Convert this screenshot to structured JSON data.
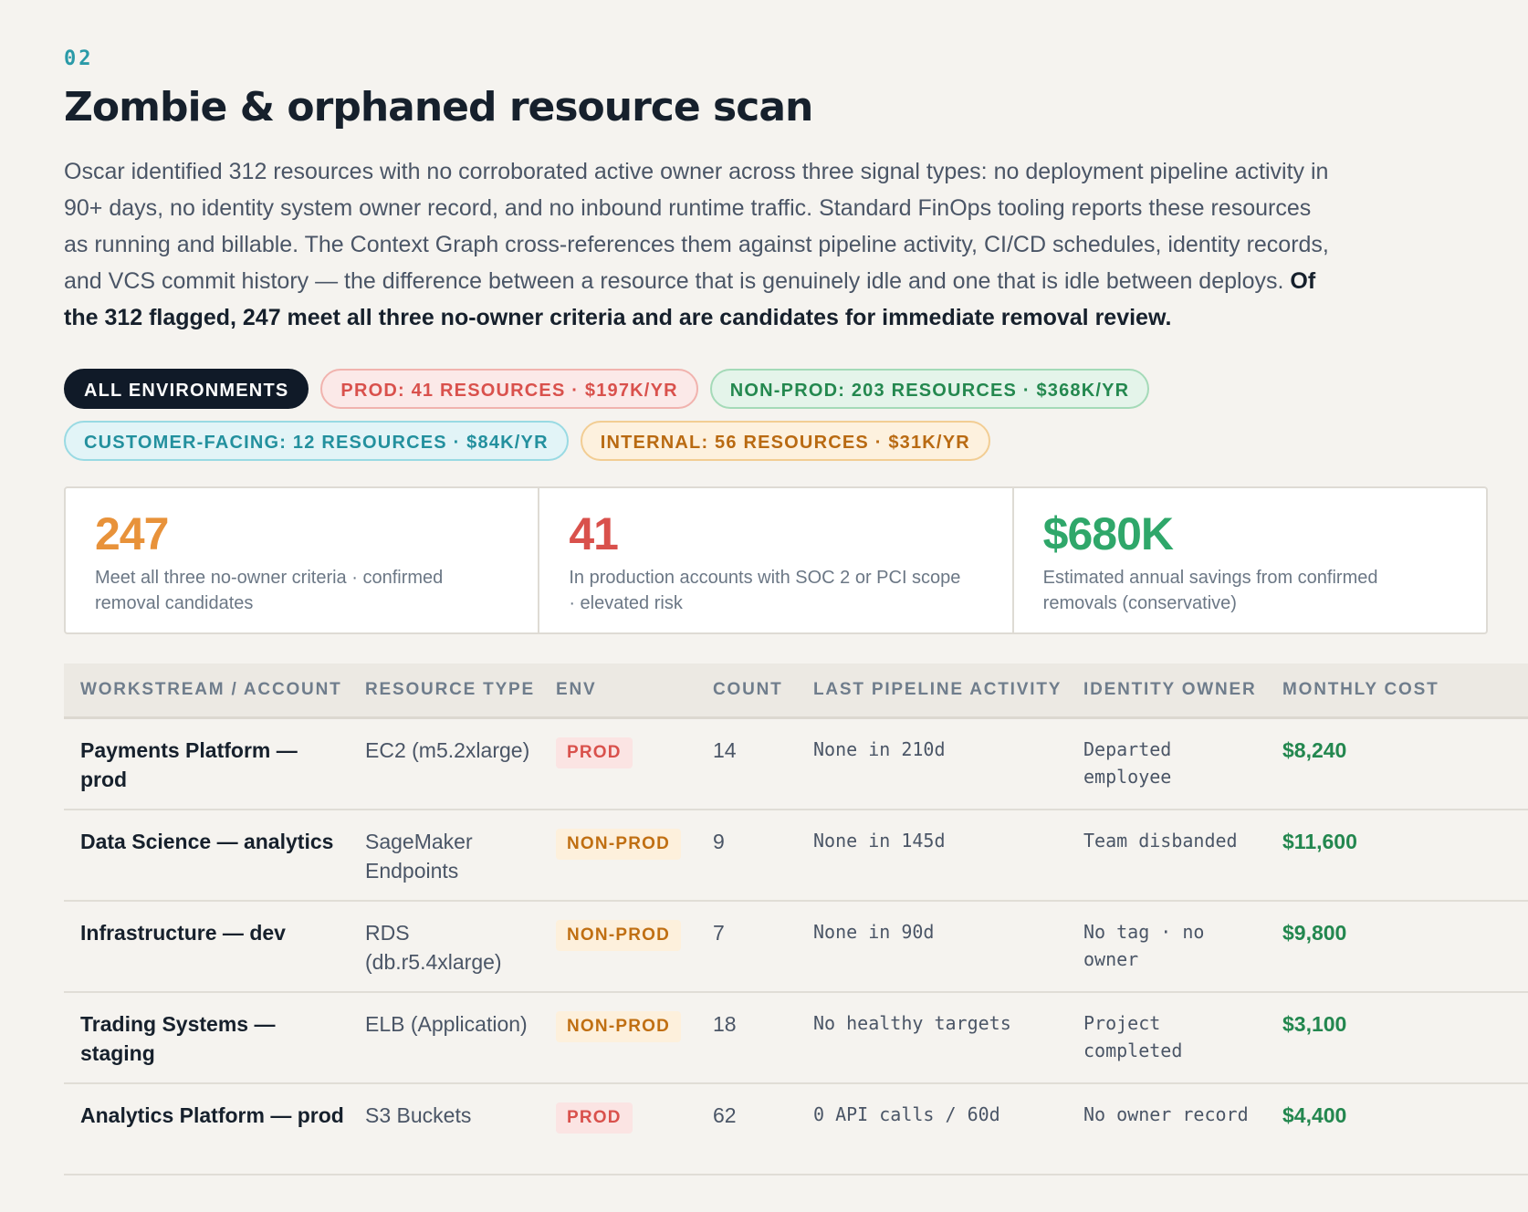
{
  "section": {
    "number": "02",
    "title": "Zombie & orphaned resource scan",
    "intro": "Oscar identified 312 resources with no corroborated active owner across three signal types: no deployment pipeline activity in 90+ days, no identity system owner record, and no inbound runtime traffic. Standard FinOps tooling reports these resources as running and billable. The Context Graph cross-references them against pipeline activity, CI/CD schedules, identity records, and VCS commit history — the difference between a resource that is genuinely idle and one that is idle between deploys. ",
    "intro_bold": "Of the 312 flagged, 247 meet all three no-owner criteria and are candidates for immediate removal review."
  },
  "filters": [
    {
      "label": "ALL ENVIRONMENTS",
      "style": "all"
    },
    {
      "label": "PROD: 41 RESOURCES · $197K/YR",
      "style": "prod"
    },
    {
      "label": "NON-PROD: 203 RESOURCES · $368K/YR",
      "style": "nonprod"
    },
    {
      "label": "CUSTOMER-FACING: 12 RESOURCES · $84K/YR",
      "style": "customer"
    },
    {
      "label": "INTERNAL: 56 RESOURCES · $31K/YR",
      "style": "internal"
    }
  ],
  "stats": [
    {
      "value": "247",
      "desc": "Meet all three no-owner criteria · confirmed removal candidates",
      "color": "#e8923a"
    },
    {
      "value": "41",
      "desc": "In production accounts with SOC 2 or PCI scope · elevated risk",
      "color": "#d9514c"
    },
    {
      "value": "$680K",
      "desc": "Estimated annual savings from confirmed removals (conservative)",
      "color": "#2fa76a"
    }
  ],
  "table": {
    "headers": [
      "WORKSTREAM / ACCOUNT",
      "RESOURCE TYPE",
      "ENV",
      "COUNT",
      "LAST PIPELINE ACTIVITY",
      "IDENTITY OWNER",
      "MONTHLY COST"
    ],
    "rows": [
      {
        "workstream": "Payments Platform — prod",
        "type": "EC2 (m5.2xlarge)",
        "env": "PROD",
        "count": "14",
        "activity": "None in 210d",
        "owner": "Departed employee",
        "cost": "$8,240"
      },
      {
        "workstream": "Data Science — analytics",
        "type": "SageMaker Endpoints",
        "env": "NON-PROD",
        "count": "9",
        "activity": "None in 145d",
        "owner": "Team disbanded",
        "cost": "$11,600"
      },
      {
        "workstream": "Infrastructure — dev",
        "type": "RDS (db.r5.4xlarge)",
        "env": "NON-PROD",
        "count": "7",
        "activity": "None in 90d",
        "owner": "No tag · no owner",
        "cost": "$9,800"
      },
      {
        "workstream": "Trading Systems — staging",
        "type": "ELB (Application)",
        "env": "NON-PROD",
        "count": "18",
        "activity": "No healthy targets",
        "owner": "Project completed",
        "cost": "$3,100"
      },
      {
        "workstream": "Analytics Platform — prod",
        "type": "S3 Buckets",
        "env": "PROD",
        "count": "62",
        "activity": "0 API calls / 60d",
        "owner": "No owner record",
        "cost": "$4,400"
      }
    ]
  }
}
